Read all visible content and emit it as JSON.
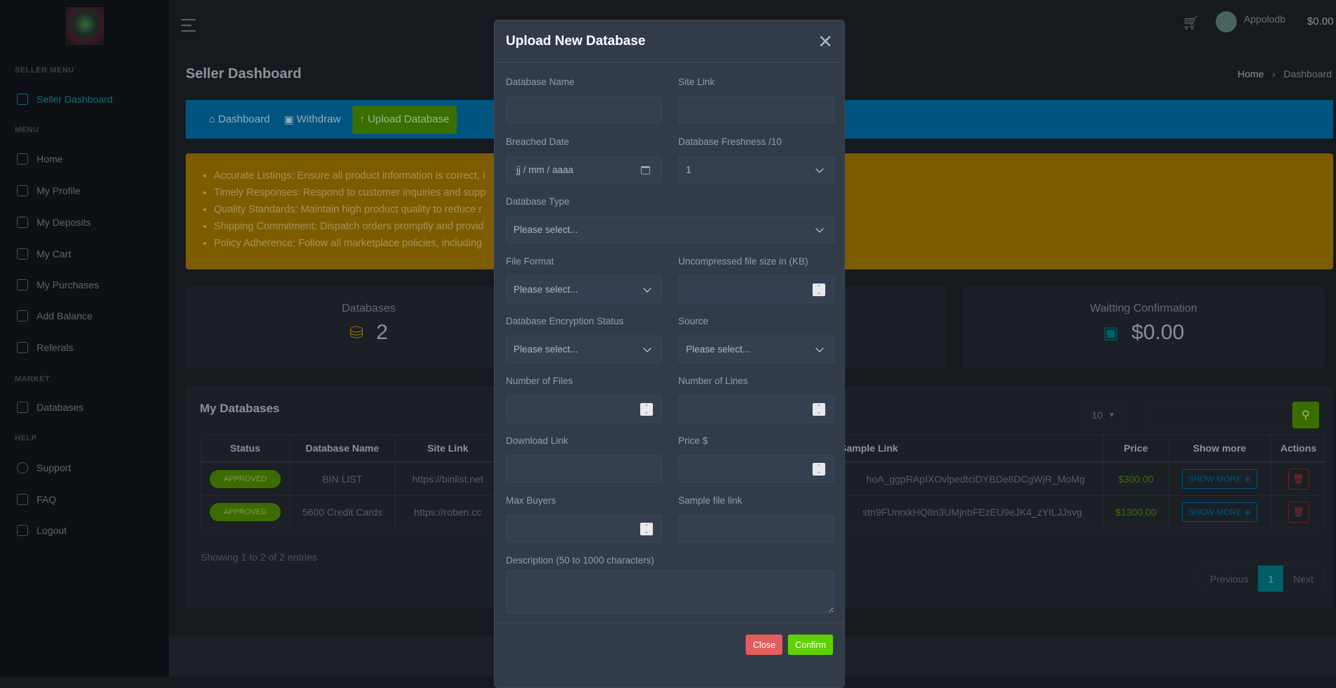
{
  "sidebar": {
    "sections": {
      "seller": "SELLER MENU",
      "menu": "MENU",
      "market": "MARKET",
      "help": "HELP"
    },
    "items": [
      {
        "label": "Seller Dashboard",
        "icon": "dashboard-icon"
      },
      {
        "label": "Home",
        "icon": "home-icon"
      },
      {
        "label": "My Profile",
        "icon": "user-icon"
      },
      {
        "label": "My Deposits",
        "icon": "wallet-icon"
      },
      {
        "label": "My Cart",
        "icon": "cart-icon"
      },
      {
        "label": "My Purchases",
        "icon": "shopping-bag-icon"
      },
      {
        "label": "Add Balance",
        "icon": "plus-square-icon"
      },
      {
        "label": "Referals",
        "icon": "users-icon"
      },
      {
        "label": "Databases",
        "icon": "database-icon"
      },
      {
        "label": "Support",
        "icon": "telegram-icon"
      },
      {
        "label": "FAQ",
        "icon": "command-icon"
      },
      {
        "label": "Logout",
        "icon": "logout-icon"
      }
    ]
  },
  "header": {
    "username": "Appolodb",
    "balance": "$0.00"
  },
  "page": {
    "title": "Seller Dashboard",
    "breadcrumb": [
      "Home",
      "Dashboard"
    ]
  },
  "nav": {
    "dashboard": "Dashboard",
    "withdraw": "Withdraw",
    "upload": "Upload Database"
  },
  "alert": [
    "Accurate Listings: Ensure all product information is correct, i",
    "Timely Responses: Respond to customer inquiries and supp",
    "Quality Standards: Maintain high product quality to reduce r",
    "Shipping Commitment: Dispatch orders promptly and provid",
    "Policy Adherence: Follow all marketplace policies, including"
  ],
  "stats": {
    "databases_label": "Databases",
    "databases_value": "2",
    "waiting_label": "Waitting Confirmation",
    "waiting_value": "$0.00"
  },
  "table": {
    "title": "My Databases",
    "page_length": "10",
    "headers": {
      "status": "Status",
      "name": "Database Name",
      "site": "Site Link",
      "sample": "Sample Link",
      "price": "Price",
      "more": "Show more",
      "actions": "Actions"
    },
    "rows": [
      {
        "status": "APPROVED",
        "name": "BIN LIST",
        "site": "https://binlist.net",
        "sample": "hoA_ggpRApIXOvlpedtciDYBDe8DCgWjR_MoMg",
        "price": "$300.00",
        "more": "SHOW MORE ⊕"
      },
      {
        "status": "APPROVED",
        "name": "5600 Credit Cards",
        "site": "https://roben.cc",
        "sample": "stn9FUnrxkHQ8n3UMjnbFEzEU9eJK4_zYtLJJsvg",
        "price": "$1300.00",
        "more": "SHOW MORE ⊕"
      }
    ],
    "info": "Showing 1 to 2 of 2 entries",
    "pagination": {
      "prev": "Previous",
      "current": "1",
      "next": "Next"
    }
  },
  "modal": {
    "title": "Upload New Database",
    "labels": {
      "db_name": "Database Name",
      "site_link": "Site Link",
      "breached": "Breached Date",
      "freshness": "Database Freshness /10",
      "type": "Database Type",
      "format": "File Format",
      "size": "Uncompressed file size in (KB)",
      "encryption": "Database Encryption Status",
      "source": "Source",
      "files": "Number of Files",
      "lines": "Number of Lines",
      "download": "Download Link",
      "price": "Price $",
      "max_buyers": "Max Buyers",
      "sample": "Sample file link",
      "description": "Description (50 to 1000 characters)"
    },
    "values": {
      "date_placeholder": "jj / mm / aaaa",
      "freshness": "1",
      "select_placeholder": "Please select..."
    },
    "buttons": {
      "close": "Close",
      "confirm": "Confirm"
    },
    "colors": {
      "close": "#e35d5d",
      "confirm": "#5fd100"
    }
  }
}
